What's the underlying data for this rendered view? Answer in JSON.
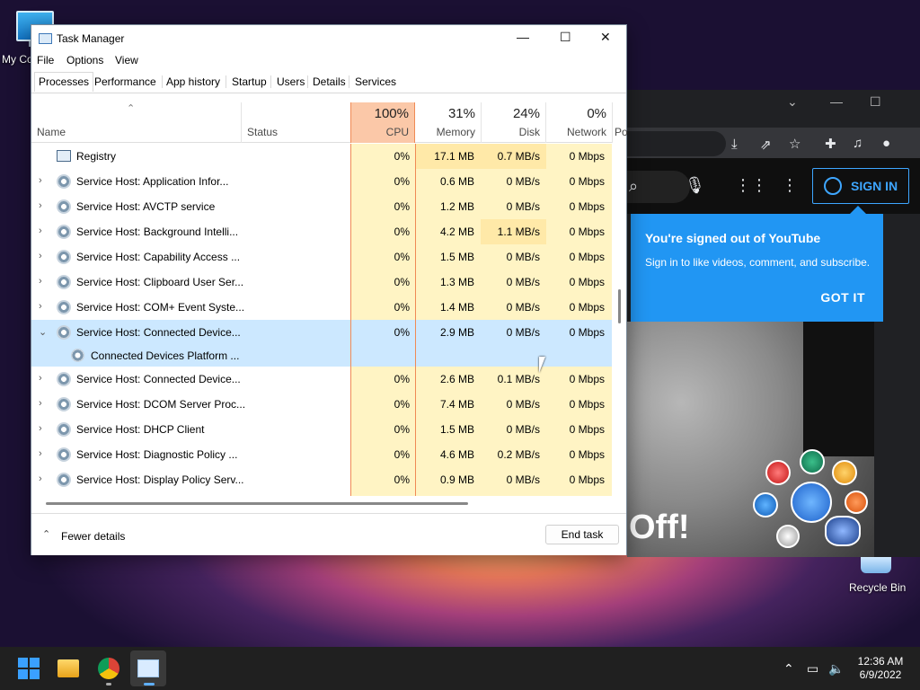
{
  "desktop": {
    "my_computer_label": "My Co",
    "recycle_bin_label": "Recycle Bin"
  },
  "chrome": {
    "signin_label": "SIGN IN",
    "tooltip_title": "You're signed out of YouTube",
    "tooltip_text": "Sign in to like videos, comment, and subscribe.",
    "tooltip_button": "GOT IT",
    "video_text": "Off!"
  },
  "task_manager": {
    "title": "Task Manager",
    "menu": [
      "File",
      "Options",
      "View"
    ],
    "tabs": [
      "Processes",
      "Performance",
      "App history",
      "Startup",
      "Users",
      "Details",
      "Services"
    ],
    "columns": {
      "name": "Name",
      "status": "Status",
      "cpu": {
        "pct": "100%",
        "label": "CPU"
      },
      "memory": {
        "pct": "31%",
        "label": "Memory"
      },
      "disk": {
        "pct": "24%",
        "label": "Disk"
      },
      "network": {
        "pct": "0%",
        "label": "Network"
      },
      "power": "Po"
    },
    "rows": [
      {
        "name": "Registry",
        "cpu": "0%",
        "memory": "17.1 MB",
        "disk": "0.7 MB/s",
        "network": "0 Mbps"
      },
      {
        "name": "Service Host: Application Infor...",
        "cpu": "0%",
        "memory": "0.6 MB",
        "disk": "0 MB/s",
        "network": "0 Mbps"
      },
      {
        "name": "Service Host: AVCTP service",
        "cpu": "0%",
        "memory": "1.2 MB",
        "disk": "0 MB/s",
        "network": "0 Mbps"
      },
      {
        "name": "Service Host: Background Intelli...",
        "cpu": "0%",
        "memory": "4.2 MB",
        "disk": "1.1 MB/s",
        "network": "0 Mbps"
      },
      {
        "name": "Service Host: Capability Access ...",
        "cpu": "0%",
        "memory": "1.5 MB",
        "disk": "0 MB/s",
        "network": "0 Mbps"
      },
      {
        "name": "Service Host: Clipboard User Ser...",
        "cpu": "0%",
        "memory": "1.3 MB",
        "disk": "0 MB/s",
        "network": "0 Mbps"
      },
      {
        "name": "Service Host: COM+ Event Syste...",
        "cpu": "0%",
        "memory": "1.4 MB",
        "disk": "0 MB/s",
        "network": "0 Mbps"
      },
      {
        "name": "Service Host: Connected Device...",
        "cpu": "0%",
        "memory": "2.9 MB",
        "disk": "0 MB/s",
        "network": "0 Mbps"
      },
      {
        "name": "Connected Devices Platform ..."
      },
      {
        "name": "Service Host: Connected Device...",
        "cpu": "0%",
        "memory": "2.6 MB",
        "disk": "0.1 MB/s",
        "network": "0 Mbps"
      },
      {
        "name": "Service Host: DCOM Server Proc...",
        "cpu": "0%",
        "memory": "7.4 MB",
        "disk": "0 MB/s",
        "network": "0 Mbps"
      },
      {
        "name": "Service Host: DHCP Client",
        "cpu": "0%",
        "memory": "1.5 MB",
        "disk": "0 MB/s",
        "network": "0 Mbps"
      },
      {
        "name": "Service Host: Diagnostic Policy ...",
        "cpu": "0%",
        "memory": "4.6 MB",
        "disk": "0.2 MB/s",
        "network": "0 Mbps"
      },
      {
        "name": "Service Host: Display Policy Serv...",
        "cpu": "0%",
        "memory": "0.9 MB",
        "disk": "0 MB/s",
        "network": "0 Mbps"
      }
    ],
    "fewer_details": "Fewer details",
    "end_task": "End task"
  },
  "taskbar": {
    "time": "12:36 AM",
    "date": "6/9/2022"
  },
  "colors": {
    "cpu_header": "#fbc8a8",
    "selected_row": "#cce8ff",
    "youtube_blue": "#2196f3"
  }
}
